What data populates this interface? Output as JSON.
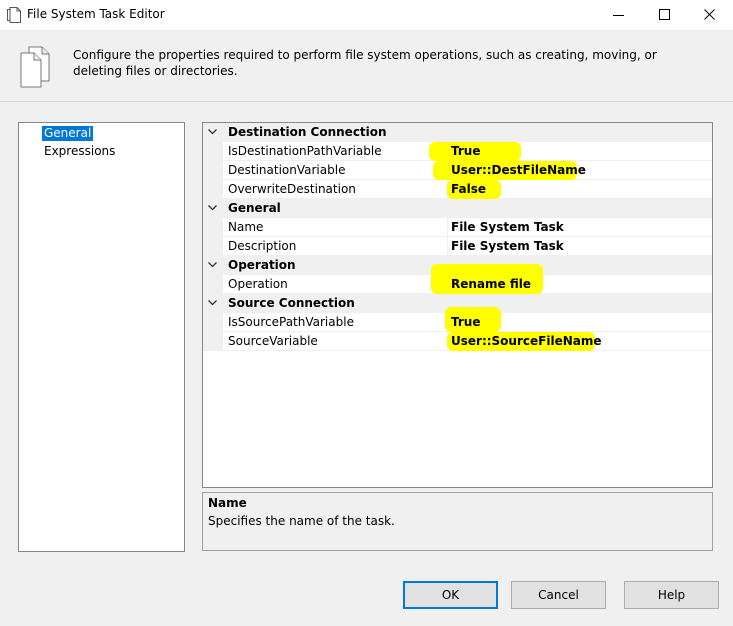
{
  "window": {
    "title": "File System Task Editor",
    "icon": "document-icon",
    "controls": [
      "minimize-icon",
      "maximize-icon",
      "close-icon"
    ]
  },
  "header": {
    "icon": "documents-icon",
    "description": "Configure the properties required to perform file system operations, such as creating, moving, or deleting files or directories."
  },
  "nav": {
    "items": [
      {
        "label": "General",
        "selected": true
      },
      {
        "label": "Expressions",
        "selected": false
      }
    ]
  },
  "grid": {
    "categories": [
      {
        "label": "Destination Connection",
        "properties": [
          {
            "name": "IsDestinationPathVariable",
            "value": "True",
            "highlighted": true
          },
          {
            "name": "DestinationVariable",
            "value": "User::DestFileName",
            "highlighted": true
          },
          {
            "name": "OverwriteDestination",
            "value": "False",
            "highlighted": true
          }
        ]
      },
      {
        "label": "General",
        "properties": [
          {
            "name": "Name",
            "value": "File System Task",
            "highlighted": false
          },
          {
            "name": "Description",
            "value": "File System Task",
            "highlighted": false
          }
        ]
      },
      {
        "label": "Operation",
        "properties": [
          {
            "name": "Operation",
            "value": "Rename file",
            "highlighted": true
          }
        ]
      },
      {
        "label": "Source Connection",
        "properties": [
          {
            "name": "IsSourcePathVariable",
            "value": "True",
            "highlighted": true
          },
          {
            "name": "SourceVariable",
            "value": "User::SourceFileName",
            "highlighted": true
          }
        ]
      }
    ]
  },
  "description_pane": {
    "title": "Name",
    "text": "Specifies the name of the task."
  },
  "buttons": {
    "ok": "OK",
    "cancel": "Cancel",
    "help": "Help"
  },
  "colors": {
    "highlight": "#ffff00",
    "selection": "#0078d7",
    "default_button_border": "#0078d7"
  }
}
